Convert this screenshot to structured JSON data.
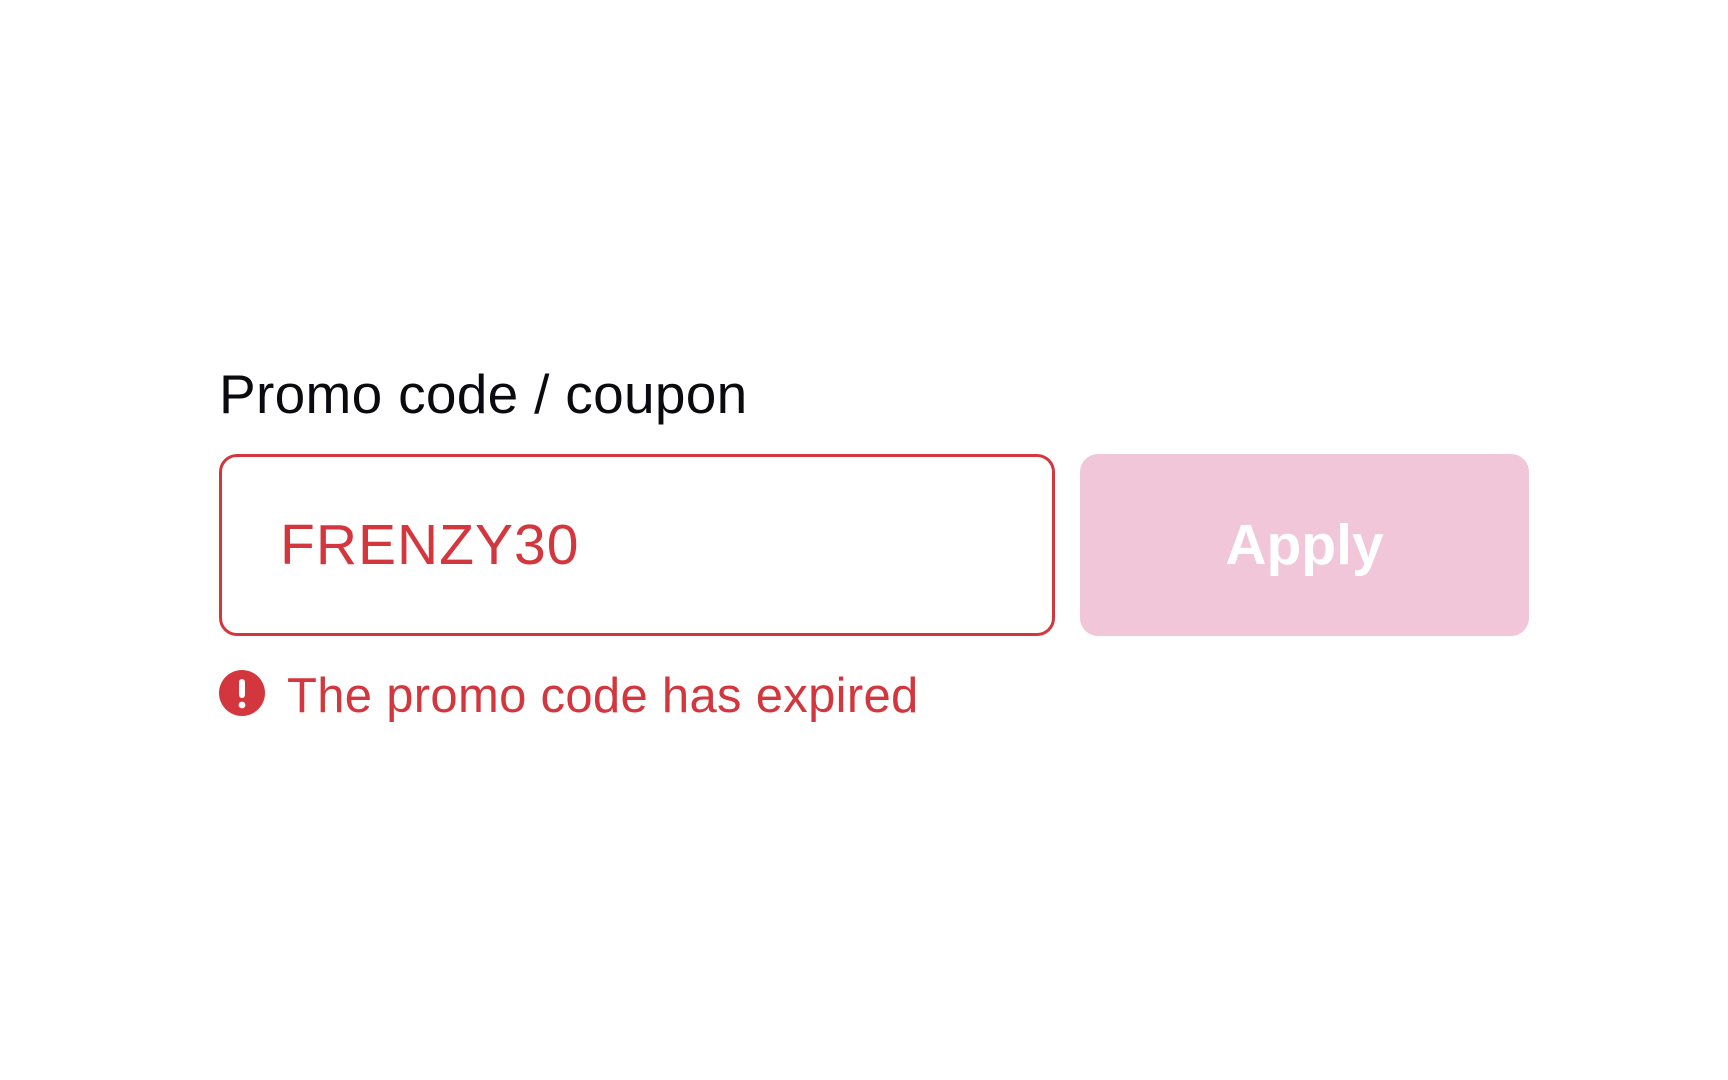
{
  "promo": {
    "label": "Promo code / coupon",
    "input_value": "FRENZY30",
    "apply_label": "Apply",
    "apply_disabled": true,
    "error_message": "The promo code has expired",
    "error_icon": "exclamation-circle-icon"
  },
  "colors": {
    "error": "#d4363d",
    "button_disabled_bg": "#f0c6d8",
    "label_text": "#0b0b0f"
  }
}
